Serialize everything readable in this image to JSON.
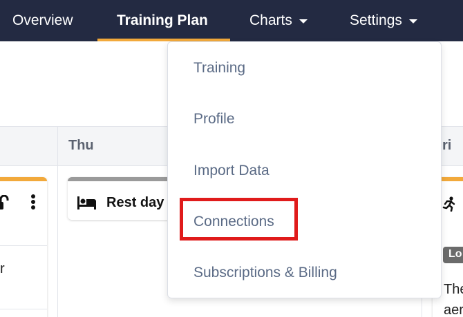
{
  "nav": {
    "items": [
      {
        "label": "Overview"
      },
      {
        "label": "Training Plan",
        "active": true
      },
      {
        "label": "Charts",
        "has_dropdown": true
      },
      {
        "label": "Settings",
        "has_dropdown": true,
        "open": true
      }
    ]
  },
  "calendar": {
    "days": [
      "Thu",
      "ri"
    ],
    "rest_card": {
      "label": "Rest day",
      "icon": "bed-icon"
    },
    "left_card": {
      "text": "r",
      "icons": [
        "lock-open-icon",
        "kebab-menu-icon"
      ]
    },
    "right_card": {
      "badge": "Lo",
      "text_line1": "The",
      "text_line2": "aer",
      "icon": "running-icon"
    }
  },
  "settings_menu": {
    "items": [
      {
        "label": "Training"
      },
      {
        "label": "Profile"
      },
      {
        "label": "Import Data"
      },
      {
        "label": "Connections",
        "highlighted": true
      },
      {
        "label": "Subscriptions & Billing"
      }
    ]
  },
  "colors": {
    "nav_bg": "#232a42",
    "accent": "#f2a93b",
    "menu_text": "#5a6a85",
    "highlight": "#e01b1b"
  }
}
